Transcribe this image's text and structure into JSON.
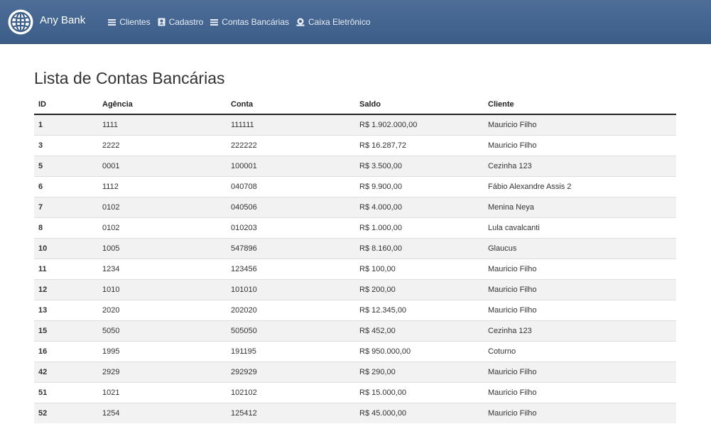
{
  "app": {
    "name": "Any Bank"
  },
  "nav": [
    {
      "label": "Clientes",
      "icon": "list-icon"
    },
    {
      "label": "Cadastro",
      "icon": "contact-card-icon"
    },
    {
      "label": "Contas Bancárias",
      "icon": "list-icon"
    },
    {
      "label": "Caixa Eletrônico",
      "icon": "atm-icon"
    }
  ],
  "page": {
    "title": "Lista de Contas Bancárias"
  },
  "table": {
    "headers": [
      "ID",
      "Agência",
      "Conta",
      "Saldo",
      "Cliente"
    ],
    "rows": [
      [
        "1",
        "1111",
        "111111",
        "R$ 1.902.000,00",
        "Mauricio Filho"
      ],
      [
        "3",
        "2222",
        "222222",
        "R$ 16.287,72",
        "Mauricio Filho"
      ],
      [
        "5",
        "0001",
        "100001",
        "R$ 3.500,00",
        "Cezinha 123"
      ],
      [
        "6",
        "1112",
        "040708",
        "R$ 9.900,00",
        "Fábio Alexandre Assis 2"
      ],
      [
        "7",
        "0102",
        "040506",
        "R$ 4.000,00",
        "Menina Neya"
      ],
      [
        "8",
        "0102",
        "010203",
        "R$ 1.000,00",
        "Lula cavalcanti"
      ],
      [
        "10",
        "1005",
        "547896",
        "R$ 8.160,00",
        "Glaucus"
      ],
      [
        "11",
        "1234",
        "123456",
        "R$ 100,00",
        "Mauricio Filho"
      ],
      [
        "12",
        "1010",
        "101010",
        "R$ 200,00",
        "Mauricio Filho"
      ],
      [
        "13",
        "2020",
        "202020",
        "R$ 12.345,00",
        "Mauricio Filho"
      ],
      [
        "15",
        "5050",
        "505050",
        "R$ 452,00",
        "Cezinha 123"
      ],
      [
        "16",
        "1995",
        "191195",
        "R$ 950.000,00",
        "Coturno"
      ],
      [
        "42",
        "2929",
        "292929",
        "R$ 290,00",
        "Mauricio Filho"
      ],
      [
        "51",
        "1021",
        "102102",
        "R$ 15.000,00",
        "Mauricio Filho"
      ],
      [
        "52",
        "1254",
        "125412",
        "R$ 45.000,00",
        "Mauricio Filho"
      ]
    ]
  }
}
